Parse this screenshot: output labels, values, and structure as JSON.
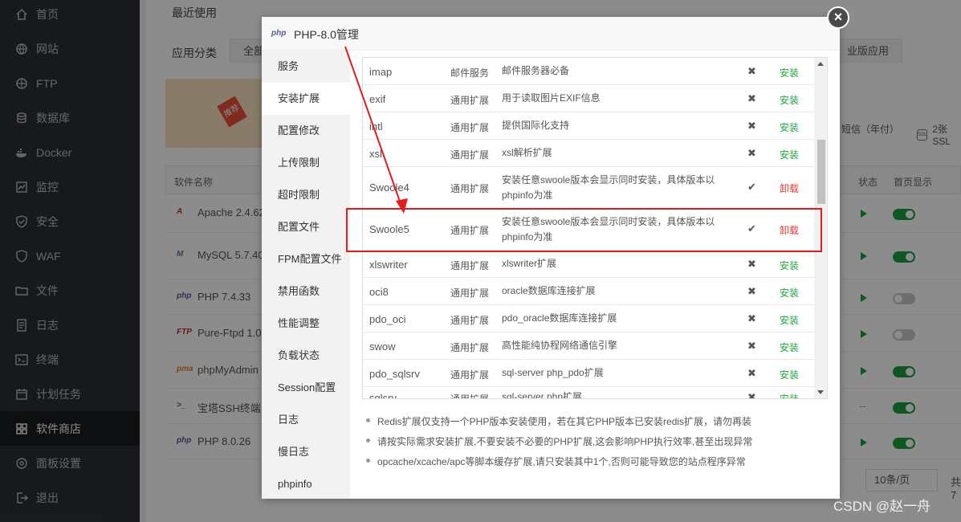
{
  "sidebar": {
    "items": [
      {
        "label": "首页",
        "icon": "home-icon"
      },
      {
        "label": "网站",
        "icon": "globe-icon"
      },
      {
        "label": "FTP",
        "icon": "ftp-icon"
      },
      {
        "label": "数据库",
        "icon": "database-icon"
      },
      {
        "label": "Docker",
        "icon": "docker-icon"
      },
      {
        "label": "监控",
        "icon": "monitor-icon"
      },
      {
        "label": "安全",
        "icon": "shield-icon"
      },
      {
        "label": "WAF",
        "icon": "waf-icon"
      },
      {
        "label": "文件",
        "icon": "folder-icon"
      },
      {
        "label": "日志",
        "icon": "log-icon"
      },
      {
        "label": "终端",
        "icon": "terminal-icon"
      },
      {
        "label": "计划任务",
        "icon": "calendar-icon"
      },
      {
        "label": "软件商店",
        "icon": "store-icon",
        "active": true
      },
      {
        "label": "面板设置",
        "icon": "gear-icon"
      },
      {
        "label": "退出",
        "icon": "logout-icon"
      }
    ]
  },
  "background": {
    "recent_title": "最近使用",
    "category_label": "应用分类",
    "cat_all": "全部",
    "cat_pro": "业版应用",
    "banner_tag": "推荐",
    "perk_1": "短信（年付）",
    "perk_2": "2张SSL",
    "col_name": "软件名称",
    "col_status": "状态",
    "col_home": "首页显示",
    "rows": [
      {
        "name": "Apache 2.4.62",
        "logo": "A"
      },
      {
        "name": "MySQL 5.7.40",
        "logo": "M"
      },
      {
        "name": "PHP 7.4.33",
        "logo": "php"
      },
      {
        "name": "Pure-Ftpd 1.0.",
        "logo": "FTP"
      },
      {
        "name": "phpMyAdmin",
        "logo": "pma"
      },
      {
        "name": "宝塔SSH终端 1",
        "logo": ">_"
      },
      {
        "name": "PHP 8.0.26",
        "logo": "php"
      }
    ],
    "dash": "--",
    "pager_size": "10条/页",
    "pager_total": "共 7"
  },
  "dialog": {
    "logo": "php",
    "title": "PHP-8.0管理",
    "close": "×",
    "tabs": [
      "服务",
      "安装扩展",
      "配置修改",
      "上传限制",
      "超时限制",
      "配置文件",
      "FPM配置文件",
      "禁用函数",
      "性能调整",
      "负载状态",
      "Session配置",
      "日志",
      "慢日志",
      "phpinfo"
    ],
    "extensions": [
      {
        "name": "imap",
        "type": "邮件服务",
        "desc": "邮件服务器必备",
        "mark": "✖",
        "action": "安装"
      },
      {
        "name": "exif",
        "type": "通用扩展",
        "desc": "用于读取图片EXIF信息",
        "mark": "✖",
        "action": "安装"
      },
      {
        "name": "intl",
        "type": "通用扩展",
        "desc": "提供国际化支持",
        "mark": "✖",
        "action": "安装"
      },
      {
        "name": "xsl",
        "type": "通用扩展",
        "desc": "xsl解析扩展",
        "mark": "✖",
        "action": "安装"
      },
      {
        "name": "Swoole4",
        "type": "通用扩展",
        "desc": "安装任意swoole版本会显示同时安装，具体版本以phpinfo为准",
        "mark": "✔",
        "action": "卸载"
      },
      {
        "name": "Swoole5",
        "type": "通用扩展",
        "desc": "安装任意swoole版本会显示同时安装，具体版本以phpinfo为准",
        "mark": "✔",
        "action": "卸载"
      },
      {
        "name": "xlswriter",
        "type": "通用扩展",
        "desc": "xlswriter扩展",
        "mark": "✖",
        "action": "安装"
      },
      {
        "name": "oci8",
        "type": "通用扩展",
        "desc": "oracle数据库连接扩展",
        "mark": "✖",
        "action": "安装"
      },
      {
        "name": "pdo_oci",
        "type": "通用扩展",
        "desc": "pdo_oracle数据库连接扩展",
        "mark": "✖",
        "action": "安装"
      },
      {
        "name": "swow",
        "type": "通用扩展",
        "desc": "高性能纯协程网络通信引擎",
        "mark": "✖",
        "action": "安装"
      },
      {
        "name": "pdo_sqlsrv",
        "type": "通用扩展",
        "desc": "sql-server php_pdo扩展",
        "mark": "✖",
        "action": "安装"
      },
      {
        "name": "sqlsrv",
        "type": "通用扩展",
        "desc": "sql-server php扩展",
        "mark": "✖",
        "action": "安装"
      }
    ],
    "notes": [
      "Redis扩展仅支持一个PHP版本安装使用，若在其它PHP版本已安装redis扩展，请勿再装",
      "请按实际需求安装扩展,不要安装不必要的PHP扩展,这会影响PHP执行效率,甚至出现异常",
      "opcache/xcache/apc等脚本缓存扩展,请只安装其中1个,否则可能导致您的站点程序异常"
    ]
  },
  "watermark": "CSDN @赵一舟",
  "colors": {
    "install": "#20a53a",
    "uninstall": "#e53935",
    "annotation": "#e61c1c",
    "sidebar_bg": "#2c2f33"
  }
}
